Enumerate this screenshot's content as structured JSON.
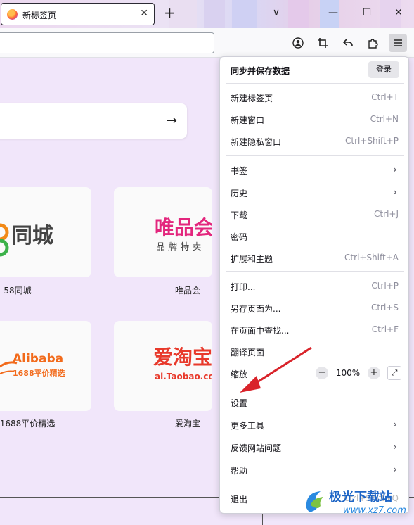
{
  "tabbar": {
    "tab_title": "新标签页",
    "close_glyph": "✕",
    "new_tab_glyph": "+",
    "list_tabs_glyph": "∨",
    "minimize_glyph": "—",
    "maximize_glyph": "☐",
    "close_window_glyph": "✕"
  },
  "content": {
    "search_arrow": "→",
    "tiles": [
      {
        "label": "58同城",
        "logo_main": "同城",
        "logo_prefix": "8"
      },
      {
        "label": "唯品会",
        "logo_main": "唯品会",
        "logo_sub": "品 牌 特 卖"
      },
      {
        "label": "1688平价精选",
        "logo_main": "Alibaba",
        "logo_sub": "1688平价精选"
      },
      {
        "label": "爱淘宝",
        "logo_main": "爱淘宝",
        "logo_sub": "ai.Taobao.com"
      }
    ]
  },
  "menu": {
    "header": "同步并保存数据",
    "signin": "登录",
    "items": [
      {
        "label": "新建标签页",
        "shortcut": "Ctrl+T"
      },
      {
        "label": "新建窗口",
        "shortcut": "Ctrl+N"
      },
      {
        "label": "新建隐私窗口",
        "shortcut": "Ctrl+Shift+P"
      },
      {
        "label": "书签",
        "chevron": "›"
      },
      {
        "label": "历史",
        "chevron": "›"
      },
      {
        "label": "下载",
        "shortcut": "Ctrl+J"
      },
      {
        "label": "密码"
      },
      {
        "label": "扩展和主题",
        "shortcut": "Ctrl+Shift+A"
      },
      {
        "label": "打印...",
        "shortcut": "Ctrl+P"
      },
      {
        "label": "另存页面为...",
        "shortcut": "Ctrl+S"
      },
      {
        "label": "在页面中查找...",
        "shortcut": "Ctrl+F"
      },
      {
        "label": "翻译页面"
      },
      {
        "label": "缩放"
      },
      {
        "label": "设置"
      },
      {
        "label": "更多工具",
        "chevron": "›"
      },
      {
        "label": "反馈网站问题",
        "chevron": "›"
      },
      {
        "label": "帮助",
        "chevron": "›"
      },
      {
        "label": "退出",
        "shortcut": "Ctrl+Shift+Q"
      }
    ],
    "zoom": {
      "minus": "−",
      "value": "100%",
      "plus": "+",
      "fullscreen": "⤢"
    }
  },
  "watermark": {
    "title": "极光下载站",
    "url": "www.xz7.com"
  }
}
